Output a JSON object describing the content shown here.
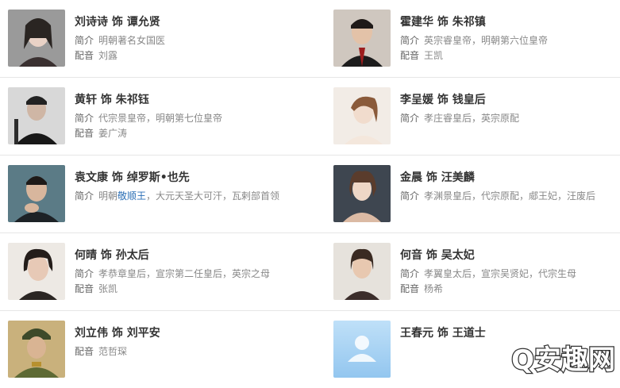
{
  "cast": [
    [
      {
        "actor": "刘诗诗",
        "sep": "饰",
        "role": "谭允贤",
        "intro": "明朝著名女国医",
        "intro_highlight": "",
        "intro_rest": "",
        "voice": "刘露",
        "photo": "portrait-icon"
      },
      {
        "actor": "霍建华",
        "sep": "饰",
        "role": "朱祁镇",
        "intro": "英宗睿皇帝，明朝第六位皇帝",
        "intro_highlight": "",
        "intro_rest": "",
        "voice": "王凯",
        "photo": "portrait-icon"
      }
    ],
    [
      {
        "actor": "黄轩",
        "sep": "饰",
        "role": "朱祁钰",
        "intro": "代宗景皇帝，明朝第七位皇帝",
        "intro_highlight": "",
        "intro_rest": "",
        "voice": "姜广涛",
        "photo": "portrait-icon"
      },
      {
        "actor": "李呈媛",
        "sep": "饰",
        "role": "钱皇后",
        "intro": "孝庄睿皇后，英宗原配",
        "intro_highlight": "",
        "intro_rest": "",
        "voice": "",
        "photo": "portrait-icon"
      }
    ],
    [
      {
        "actor": "袁文康",
        "sep": "饰",
        "role": "绰罗斯•也先",
        "intro": "明朝",
        "intro_highlight": "敬顺王",
        "intro_rest": "，大元天圣大可汗，瓦剌部首领",
        "voice": "",
        "photo": "portrait-icon"
      },
      {
        "actor": "金晨",
        "sep": "饰",
        "role": "汪美麟",
        "intro": "孝渊景皇后，代宗原配，郕王妃，汪废后",
        "intro_highlight": "",
        "intro_rest": "",
        "voice": "",
        "photo": "portrait-icon"
      }
    ],
    [
      {
        "actor": "何晴",
        "sep": "饰",
        "role": "孙太后",
        "intro": "孝恭章皇后，宣宗第二任皇后，英宗之母",
        "intro_highlight": "",
        "intro_rest": "",
        "voice": "张凯",
        "photo": "portrait-icon"
      },
      {
        "actor": "何音",
        "sep": "饰",
        "role": "吴太妃",
        "intro": "孝翼皇太后，宣宗吴贤妃，代宗生母",
        "intro_highlight": "",
        "intro_rest": "",
        "voice": "杨希",
        "photo": "portrait-icon"
      }
    ],
    [
      {
        "actor": "刘立伟",
        "sep": "饰",
        "role": "刘平安",
        "intro": "",
        "intro_highlight": "",
        "intro_rest": "",
        "voice": "范哲琛",
        "photo": "portrait-icon"
      },
      {
        "actor": "王春元",
        "sep": "饰",
        "role": "王道士",
        "intro": "",
        "intro_highlight": "",
        "intro_rest": "",
        "voice": "",
        "photo": "default-avatar-icon"
      }
    ]
  ],
  "labels": {
    "intro": "简介",
    "voice": "配音"
  },
  "watermark": {
    "text": "Q安趣网"
  },
  "colors": {
    "accent": "#2b6fb6",
    "avatar_bg": "#a9d4f5"
  }
}
